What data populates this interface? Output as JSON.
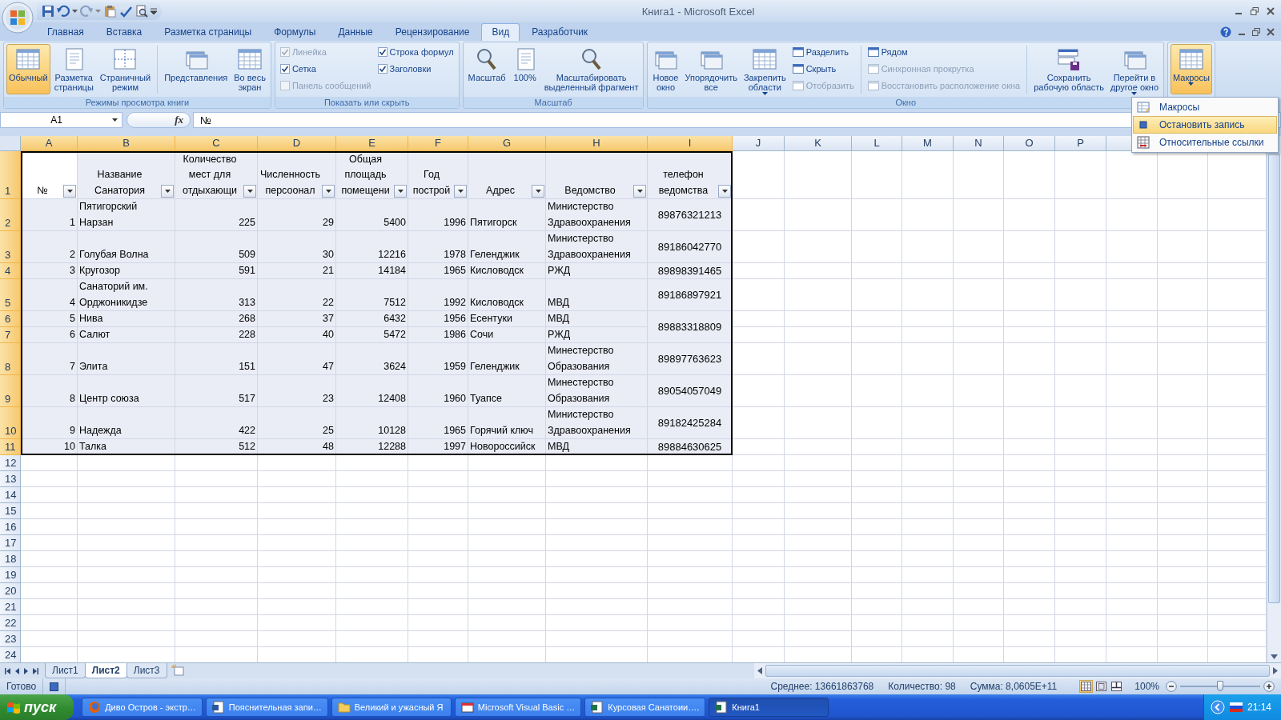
{
  "window": {
    "title": "Книга1 - Microsoft Excel"
  },
  "ribbon": {
    "tabs": [
      {
        "label": "Главная",
        "selected": false
      },
      {
        "label": "Вставка",
        "selected": false
      },
      {
        "label": "Разметка страницы",
        "selected": false
      },
      {
        "label": "Формулы",
        "selected": false
      },
      {
        "label": "Данные",
        "selected": false
      },
      {
        "label": "Рецензирование",
        "selected": false
      },
      {
        "label": "Вид",
        "selected": true
      },
      {
        "label": "Разработчик",
        "selected": false
      }
    ],
    "groups": [
      {
        "title": "Режимы просмотра книги",
        "items": [
          {
            "kind": "large",
            "label": "Обычный",
            "selected": true
          },
          {
            "kind": "large",
            "label": "Разметка\nстраницы",
            "selected": false
          },
          {
            "kind": "large",
            "label": "Страничный\nрежим",
            "selected": false
          },
          {
            "kind": "large",
            "label": "Представления",
            "selected": false,
            "separator_before": true
          },
          {
            "kind": "large",
            "label": "Во весь\nэкран",
            "selected": false
          }
        ]
      },
      {
        "title": "Показать или скрыть",
        "items": [
          {
            "kind": "check",
            "label": "Линейка",
            "checked": true,
            "disabled": true
          },
          {
            "kind": "check",
            "label": "Сетка",
            "checked": true,
            "disabled": false
          },
          {
            "kind": "check",
            "label": "Панель сообщений",
            "checked": false,
            "disabled": true
          },
          {
            "kind": "check",
            "label": "Строка формул",
            "checked": true,
            "disabled": false
          },
          {
            "kind": "check",
            "label": "Заголовки",
            "checked": true,
            "disabled": false
          }
        ]
      },
      {
        "title": "Масштаб",
        "items": [
          {
            "kind": "large",
            "label": "Масштаб",
            "selected": false
          },
          {
            "kind": "large",
            "label": "100%",
            "selected": false
          },
          {
            "kind": "large",
            "label": "Масштабировать\nвыделенный фрагмент",
            "selected": false
          }
        ]
      },
      {
        "title": "Окно",
        "items": [
          {
            "kind": "large",
            "label": "Новое\nокно",
            "selected": false
          },
          {
            "kind": "large",
            "label": "Упорядочить\nвсе",
            "selected": false
          },
          {
            "kind": "large",
            "label": "Закрепить\nобласти",
            "selected": false,
            "dropdown": true
          },
          {
            "kind": "small",
            "label": "Разделить",
            "disabled": false
          },
          {
            "kind": "small",
            "label": "Скрыть",
            "disabled": false
          },
          {
            "kind": "small",
            "label": "Отобразить",
            "disabled": true
          },
          {
            "kind": "small",
            "label": "Рядом",
            "disabled": false,
            "separator_before": true
          },
          {
            "kind": "small",
            "label": "Синхронная прокрутка",
            "disabled": true
          },
          {
            "kind": "small",
            "label": "Восстановить расположение окна",
            "disabled": true
          },
          {
            "kind": "large",
            "label": "Сохранить\nрабочую область",
            "selected": false,
            "separator_before": true
          },
          {
            "kind": "large",
            "label": "Перейти в\nдругое окно",
            "selected": false,
            "dropdown": true
          }
        ]
      },
      {
        "items": [
          {
            "kind": "large",
            "label": "Макросы",
            "selected": true,
            "dropdown": true
          }
        ]
      }
    ]
  },
  "macro_menu": {
    "items": [
      {
        "label": "Макросы",
        "selected": false
      },
      {
        "label": "Остановить запись",
        "selected": true
      },
      {
        "label": "Относительные ссылки",
        "selected": false
      }
    ]
  },
  "formula_bar": {
    "name_box": "A1",
    "function_label": "fx",
    "formula": "№"
  },
  "sheet": {
    "columns": [
      {
        "label": "A",
        "selected": true
      },
      {
        "label": "B",
        "selected": true
      },
      {
        "label": "C",
        "selected": true
      },
      {
        "label": "D",
        "selected": true
      },
      {
        "label": "E",
        "selected": true
      },
      {
        "label": "F",
        "selected": true
      },
      {
        "label": "G",
        "selected": true
      },
      {
        "label": "H",
        "selected": true
      },
      {
        "label": "I",
        "selected": true
      },
      {
        "label": "J",
        "selected": false
      },
      {
        "label": "K",
        "selected": false
      },
      {
        "label": "L",
        "selected": false
      },
      {
        "label": "M",
        "selected": false
      },
      {
        "label": "N",
        "selected": false
      },
      {
        "label": "O",
        "selected": false
      },
      {
        "label": "P",
        "selected": false
      }
    ],
    "header_row": {
      "number": "1",
      "selected": true,
      "cells": [
        {
          "text": "№",
          "active": true,
          "filter": true
        },
        {
          "text": "Название\nСанатория",
          "active": false,
          "filter": true
        },
        {
          "text": "Количество\nмест для\nотдыхающи",
          "active": false,
          "filter": true
        },
        {
          "text": "Численность\nперсоонал",
          "active": false,
          "filter": true
        },
        {
          "text": "Общая\nплощадь\nпомещени",
          "active": false,
          "filter": true
        },
        {
          "text": "Год\nпострой",
          "active": false,
          "filter": true
        },
        {
          "text": "Адрес",
          "active": false,
          "filter": true
        },
        {
          "text": "Ведомство",
          "active": false,
          "filter": true
        },
        {
          "text": "телефон\nведомства",
          "active": false,
          "filter": true
        }
      ]
    },
    "rows": [
      {
        "number": "2",
        "selected": true,
        "cells": [
          "1",
          "Пятигорский\nНарзан",
          "225",
          "29",
          "5400",
          "1996",
          "Пятигорск",
          "Министерство\nЗдравоохранения",
          "89876321213"
        ]
      },
      {
        "number": "3",
        "selected": true,
        "cells": [
          "2",
          "Голубая Волна",
          "509",
          "30",
          "12216",
          "1978",
          "Геленджик",
          "Министерство\nЗдравоохранения",
          "89186042770"
        ]
      },
      {
        "number": "4",
        "selected": true,
        "cells": [
          "3",
          "Кругозор",
          "591",
          "21",
          "14184",
          "1965",
          "Кисловодск",
          "РЖД",
          "89898391465"
        ]
      },
      {
        "number": "5",
        "selected": true,
        "cells": [
          "4",
          "Санаторий им.\nОрджоникидзе",
          "313",
          "22",
          "7512",
          "1992",
          "Кисловодск",
          "МВД",
          "89186897921"
        ]
      },
      {
        "number": "6",
        "selected": true,
        "merged_down": true,
        "cells": [
          "5",
          "Нива",
          "268",
          "37",
          "6432",
          "1956",
          "Есентуки",
          "МВД",
          "89883318809"
        ]
      },
      {
        "number": "7",
        "selected": true,
        "cells": [
          "6",
          "Салют",
          "228",
          "40",
          "5472",
          "1986",
          "Сочи",
          "РЖД"
        ]
      },
      {
        "number": "8",
        "selected": true,
        "cells": [
          "7",
          "Элита",
          "151",
          "47",
          "3624",
          "1959",
          "Геленджик",
          "Минестерство\nОбразования",
          "89897763623"
        ]
      },
      {
        "number": "9",
        "selected": true,
        "cells": [
          "8",
          "Центр союза",
          "517",
          "23",
          "12408",
          "1960",
          "Туапсе",
          "Минестерство\nОбразования",
          "89054057049"
        ]
      },
      {
        "number": "10",
        "selected": true,
        "cells": [
          "9",
          "Надежда",
          "422",
          "25",
          "10128",
          "1965",
          "Горячий ключ",
          "Министерство\nЗдравоохранения",
          "89182425284"
        ]
      },
      {
        "number": "11",
        "selected": true,
        "cells": [
          "10",
          "Талка",
          "512",
          "48",
          "12288",
          "1997",
          "Новороссийск",
          "МВД",
          "89884630625"
        ]
      }
    ],
    "empty_rows": [
      {
        "number": "12",
        "selected": false
      },
      {
        "number": "13",
        "selected": false
      },
      {
        "number": "14",
        "selected": false
      },
      {
        "number": "15",
        "selected": false
      },
      {
        "number": "16",
        "selected": false
      },
      {
        "number": "17",
        "selected": false
      },
      {
        "number": "18",
        "selected": false
      },
      {
        "number": "19",
        "selected": false
      },
      {
        "number": "20",
        "selected": false
      },
      {
        "number": "21",
        "selected": false
      },
      {
        "number": "22",
        "selected": false
      },
      {
        "number": "23",
        "selected": false
      },
      {
        "number": "24",
        "selected": false
      }
    ]
  },
  "sheet_tabs": [
    {
      "label": "Лист1",
      "selected": false
    },
    {
      "label": "Лист2",
      "selected": true
    },
    {
      "label": "Лист3",
      "selected": false
    }
  ],
  "status_bar": {
    "mode": "Готово",
    "stats": [
      "Среднее: 13661863768",
      "Количество: 98",
      "Сумма: 8,0605E+11"
    ],
    "view_buttons": [
      {
        "selected": true
      },
      {
        "selected": false
      },
      {
        "selected": false
      }
    ],
    "zoom": "100%",
    "zoom_slider": {
      "level": 0.5
    }
  },
  "taskbar": {
    "start": "пуск",
    "tasks": [
      {
        "label": "Диво Остров - экстр…",
        "selected": false
      },
      {
        "label": "Пояснительная запи…",
        "selected": false
      },
      {
        "label": "Великий и ужасный Я",
        "selected": false
      },
      {
        "label": "Microsoft Visual Basic …",
        "selected": false
      },
      {
        "label": "Курсовая Санатоии….",
        "selected": false
      },
      {
        "label": "Книга1",
        "selected": true
      }
    ],
    "clock": "21:14"
  }
}
